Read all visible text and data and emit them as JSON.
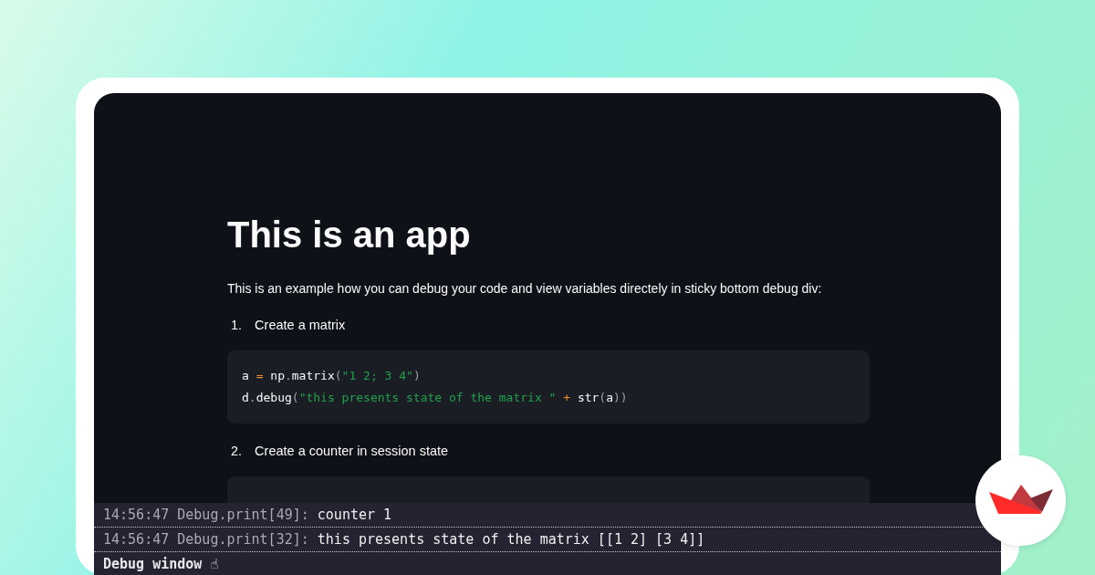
{
  "app": {
    "title": "This is an app",
    "intro": "This is an example how you can debug your code and view variables directely in sticky bottom debug div:",
    "steps": [
      {
        "number": "1.",
        "label": "Create a matrix",
        "code": [
          [
            {
              "text": "a",
              "kind": "plain"
            },
            {
              "text": " = ",
              "kind": "op"
            },
            {
              "text": "np",
              "kind": "plain"
            },
            {
              "text": ".",
              "kind": "punct"
            },
            {
              "text": "matrix",
              "kind": "plain"
            },
            {
              "text": "(",
              "kind": "punct"
            },
            {
              "text": "\"1 2; 3 4\"",
              "kind": "string"
            },
            {
              "text": ")",
              "kind": "punct"
            }
          ],
          [
            {
              "text": "d",
              "kind": "plain"
            },
            {
              "text": ".",
              "kind": "punct"
            },
            {
              "text": "debug",
              "kind": "plain"
            },
            {
              "text": "(",
              "kind": "punct"
            },
            {
              "text": "\"this presents state of the matrix \"",
              "kind": "string"
            },
            {
              "text": " + ",
              "kind": "op"
            },
            {
              "text": "str",
              "kind": "plain"
            },
            {
              "text": "(",
              "kind": "punct"
            },
            {
              "text": "a",
              "kind": "plain"
            },
            {
              "text": "))",
              "kind": "punct"
            }
          ]
        ]
      },
      {
        "number": "2.",
        "label": "Create a counter in session state"
      }
    ]
  },
  "debug_window": {
    "entries": [
      {
        "time": "14:56:47 Debug.print[49]:",
        "message": "counter 1"
      },
      {
        "time": "14:56:47 Debug.print[32]:",
        "message": "this presents state of the matrix [[1 2] [3 4]]"
      }
    ],
    "title": "Debug window ☝"
  }
}
